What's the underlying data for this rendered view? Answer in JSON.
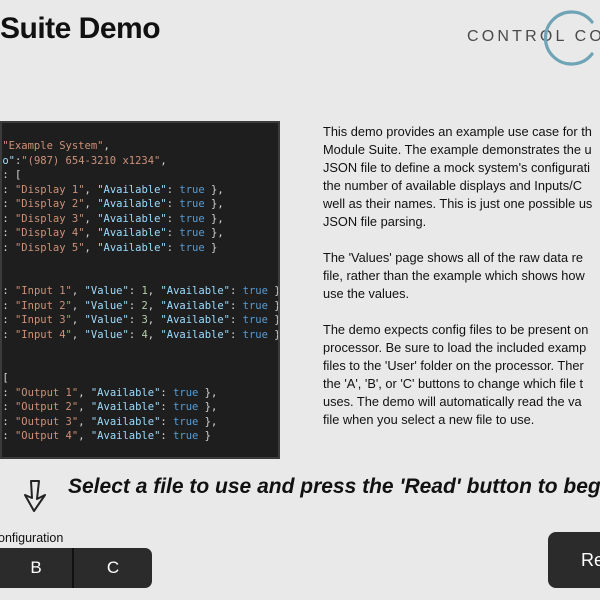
{
  "header": {
    "title": "Suite Demo",
    "brand_text": "CONTROL CON"
  },
  "code_lines": [
    [
      {
        "t": ":",
        "c": "p"
      },
      {
        "t": "\"Example System\"",
        "c": "s"
      },
      {
        "t": ",",
        "c": "p"
      }
    ],
    [
      {
        "t": "fo\"",
        "c": "k"
      },
      {
        "t": ":",
        "c": "p"
      },
      {
        "t": "\"(987) 654-3210 x1234\"",
        "c": "s"
      },
      {
        "t": ",",
        "c": "p"
      }
    ],
    [
      {
        "t": " ",
        "c": "p"
      },
      {
        "t": ":",
        "c": "p"
      },
      {
        "t": " [",
        "c": "p"
      }
    ],
    [
      {
        "t": "\"",
        "c": "k"
      },
      {
        "t": ": ",
        "c": "p"
      },
      {
        "t": "\"Display 1\"",
        "c": "s"
      },
      {
        "t": ", ",
        "c": "p"
      },
      {
        "t": "\"Available\"",
        "c": "k"
      },
      {
        "t": ": ",
        "c": "p"
      },
      {
        "t": "true",
        "c": "b"
      },
      {
        "t": " },",
        "c": "p"
      }
    ],
    [
      {
        "t": "\"",
        "c": "k"
      },
      {
        "t": ": ",
        "c": "p"
      },
      {
        "t": "\"Display 2\"",
        "c": "s"
      },
      {
        "t": ", ",
        "c": "p"
      },
      {
        "t": "\"Available\"",
        "c": "k"
      },
      {
        "t": ": ",
        "c": "p"
      },
      {
        "t": "true",
        "c": "b"
      },
      {
        "t": " },",
        "c": "p"
      }
    ],
    [
      {
        "t": "\"",
        "c": "k"
      },
      {
        "t": ": ",
        "c": "p"
      },
      {
        "t": "\"Display 3\"",
        "c": "s"
      },
      {
        "t": ", ",
        "c": "p"
      },
      {
        "t": "\"Available\"",
        "c": "k"
      },
      {
        "t": ": ",
        "c": "p"
      },
      {
        "t": "true",
        "c": "b"
      },
      {
        "t": " },",
        "c": "p"
      }
    ],
    [
      {
        "t": "\"",
        "c": "k"
      },
      {
        "t": ": ",
        "c": "p"
      },
      {
        "t": "\"Display 4\"",
        "c": "s"
      },
      {
        "t": ", ",
        "c": "p"
      },
      {
        "t": "\"Available\"",
        "c": "k"
      },
      {
        "t": ": ",
        "c": "p"
      },
      {
        "t": "true",
        "c": "b"
      },
      {
        "t": " },",
        "c": "p"
      }
    ],
    [
      {
        "t": "\"",
        "c": "k"
      },
      {
        "t": ": ",
        "c": "p"
      },
      {
        "t": "\"Display 5\"",
        "c": "s"
      },
      {
        "t": ", ",
        "c": "p"
      },
      {
        "t": "\"Available\"",
        "c": "k"
      },
      {
        "t": ": ",
        "c": "p"
      },
      {
        "t": "true",
        "c": "b"
      },
      {
        "t": " }",
        "c": "p"
      }
    ],
    [
      {
        "t": "",
        "c": "p"
      }
    ],
    [
      {
        "t": "",
        "c": "p"
      }
    ],
    [
      {
        "t": "\"",
        "c": "k"
      },
      {
        "t": ": ",
        "c": "p"
      },
      {
        "t": "\"Input 1\"",
        "c": "s"
      },
      {
        "t": ", ",
        "c": "p"
      },
      {
        "t": "\"Value\"",
        "c": "k"
      },
      {
        "t": ": ",
        "c": "p"
      },
      {
        "t": "1",
        "c": "n"
      },
      {
        "t": ", ",
        "c": "p"
      },
      {
        "t": "\"Available\"",
        "c": "k"
      },
      {
        "t": ": ",
        "c": "p"
      },
      {
        "t": "true",
        "c": "b"
      },
      {
        "t": " },",
        "c": "p"
      }
    ],
    [
      {
        "t": "\"",
        "c": "k"
      },
      {
        "t": ": ",
        "c": "p"
      },
      {
        "t": "\"Input 2\"",
        "c": "s"
      },
      {
        "t": ", ",
        "c": "p"
      },
      {
        "t": "\"Value\"",
        "c": "k"
      },
      {
        "t": ": ",
        "c": "p"
      },
      {
        "t": "2",
        "c": "n"
      },
      {
        "t": ", ",
        "c": "p"
      },
      {
        "t": "\"Available\"",
        "c": "k"
      },
      {
        "t": ": ",
        "c": "p"
      },
      {
        "t": "true",
        "c": "b"
      },
      {
        "t": " },",
        "c": "p"
      }
    ],
    [
      {
        "t": "\"",
        "c": "k"
      },
      {
        "t": ": ",
        "c": "p"
      },
      {
        "t": "\"Input 3\"",
        "c": "s"
      },
      {
        "t": ", ",
        "c": "p"
      },
      {
        "t": "\"Value\"",
        "c": "k"
      },
      {
        "t": ": ",
        "c": "p"
      },
      {
        "t": "3",
        "c": "n"
      },
      {
        "t": ", ",
        "c": "p"
      },
      {
        "t": "\"Available\"",
        "c": "k"
      },
      {
        "t": ": ",
        "c": "p"
      },
      {
        "t": "true",
        "c": "b"
      },
      {
        "t": " },",
        "c": "p"
      }
    ],
    [
      {
        "t": "\"",
        "c": "k"
      },
      {
        "t": ": ",
        "c": "p"
      },
      {
        "t": "\"Input 4\"",
        "c": "s"
      },
      {
        "t": ", ",
        "c": "p"
      },
      {
        "t": "\"Value\"",
        "c": "k"
      },
      {
        "t": ": ",
        "c": "p"
      },
      {
        "t": "4",
        "c": "n"
      },
      {
        "t": ", ",
        "c": "p"
      },
      {
        "t": "\"Available\"",
        "c": "k"
      },
      {
        "t": ": ",
        "c": "p"
      },
      {
        "t": "true",
        "c": "b"
      },
      {
        "t": " }",
        "c": "p"
      }
    ],
    [
      {
        "t": "",
        "c": "p"
      }
    ],
    [
      {
        "t": "",
        "c": "p"
      }
    ],
    [
      {
        "t": " [",
        "c": "p"
      }
    ],
    [
      {
        "t": "\"",
        "c": "k"
      },
      {
        "t": ": ",
        "c": "p"
      },
      {
        "t": "\"Output 1\"",
        "c": "s"
      },
      {
        "t": ", ",
        "c": "p"
      },
      {
        "t": "\"Available\"",
        "c": "k"
      },
      {
        "t": ": ",
        "c": "p"
      },
      {
        "t": "true",
        "c": "b"
      },
      {
        "t": " },",
        "c": "p"
      }
    ],
    [
      {
        "t": "\"",
        "c": "k"
      },
      {
        "t": ": ",
        "c": "p"
      },
      {
        "t": "\"Output 2\"",
        "c": "s"
      },
      {
        "t": ", ",
        "c": "p"
      },
      {
        "t": "\"Available\"",
        "c": "k"
      },
      {
        "t": ": ",
        "c": "p"
      },
      {
        "t": "true",
        "c": "b"
      },
      {
        "t": " },",
        "c": "p"
      }
    ],
    [
      {
        "t": "\"",
        "c": "k"
      },
      {
        "t": ": ",
        "c": "p"
      },
      {
        "t": "\"Output 3\"",
        "c": "s"
      },
      {
        "t": ", ",
        "c": "p"
      },
      {
        "t": "\"Available\"",
        "c": "k"
      },
      {
        "t": ": ",
        "c": "p"
      },
      {
        "t": "true",
        "c": "b"
      },
      {
        "t": " },",
        "c": "p"
      }
    ],
    [
      {
        "t": "\"",
        "c": "k"
      },
      {
        "t": ": ",
        "c": "p"
      },
      {
        "t": "\"Output 4\"",
        "c": "s"
      },
      {
        "t": ", ",
        "c": "p"
      },
      {
        "t": "\"Available\"",
        "c": "k"
      },
      {
        "t": ": ",
        "c": "p"
      },
      {
        "t": "true",
        "c": "b"
      },
      {
        "t": " }",
        "c": "p"
      }
    ]
  ],
  "description": {
    "para1": "This demo provides an example use case for th\nModule Suite. The example demonstrates the u\nJSON file to define a mock system's configurati\nthe number of available displays and Inputs/C\nwell as their names. This is just one possible us\nJSON file parsing.",
    "para2": "The 'Values' page shows all of the raw data re\nfile, rather than the example which shows how\nuse the values.",
    "para3": "The demo expects config files to be present on\nprocessor. Be sure to load the included examp\nfiles to the 'User' folder on the processor. Ther\nthe 'A', 'B', or 'C' buttons to change which file t\nuses. The demo will automatically read the va\nfile when you select a new file to use."
  },
  "instruction": "Select a file to use and press the 'Read' button to begin.",
  "config": {
    "label": "onfiguration",
    "buttons": [
      "B",
      "C"
    ]
  },
  "read_button": "Re",
  "icons": {
    "brand": "ring-logo-icon",
    "instruction": "arrow-down-icon"
  },
  "colors": {
    "background": "#e9e9e9",
    "button_bg": "#2b2b2b",
    "brand_ring": "#6fa3b6",
    "code_bg": "#1e1e1e"
  }
}
